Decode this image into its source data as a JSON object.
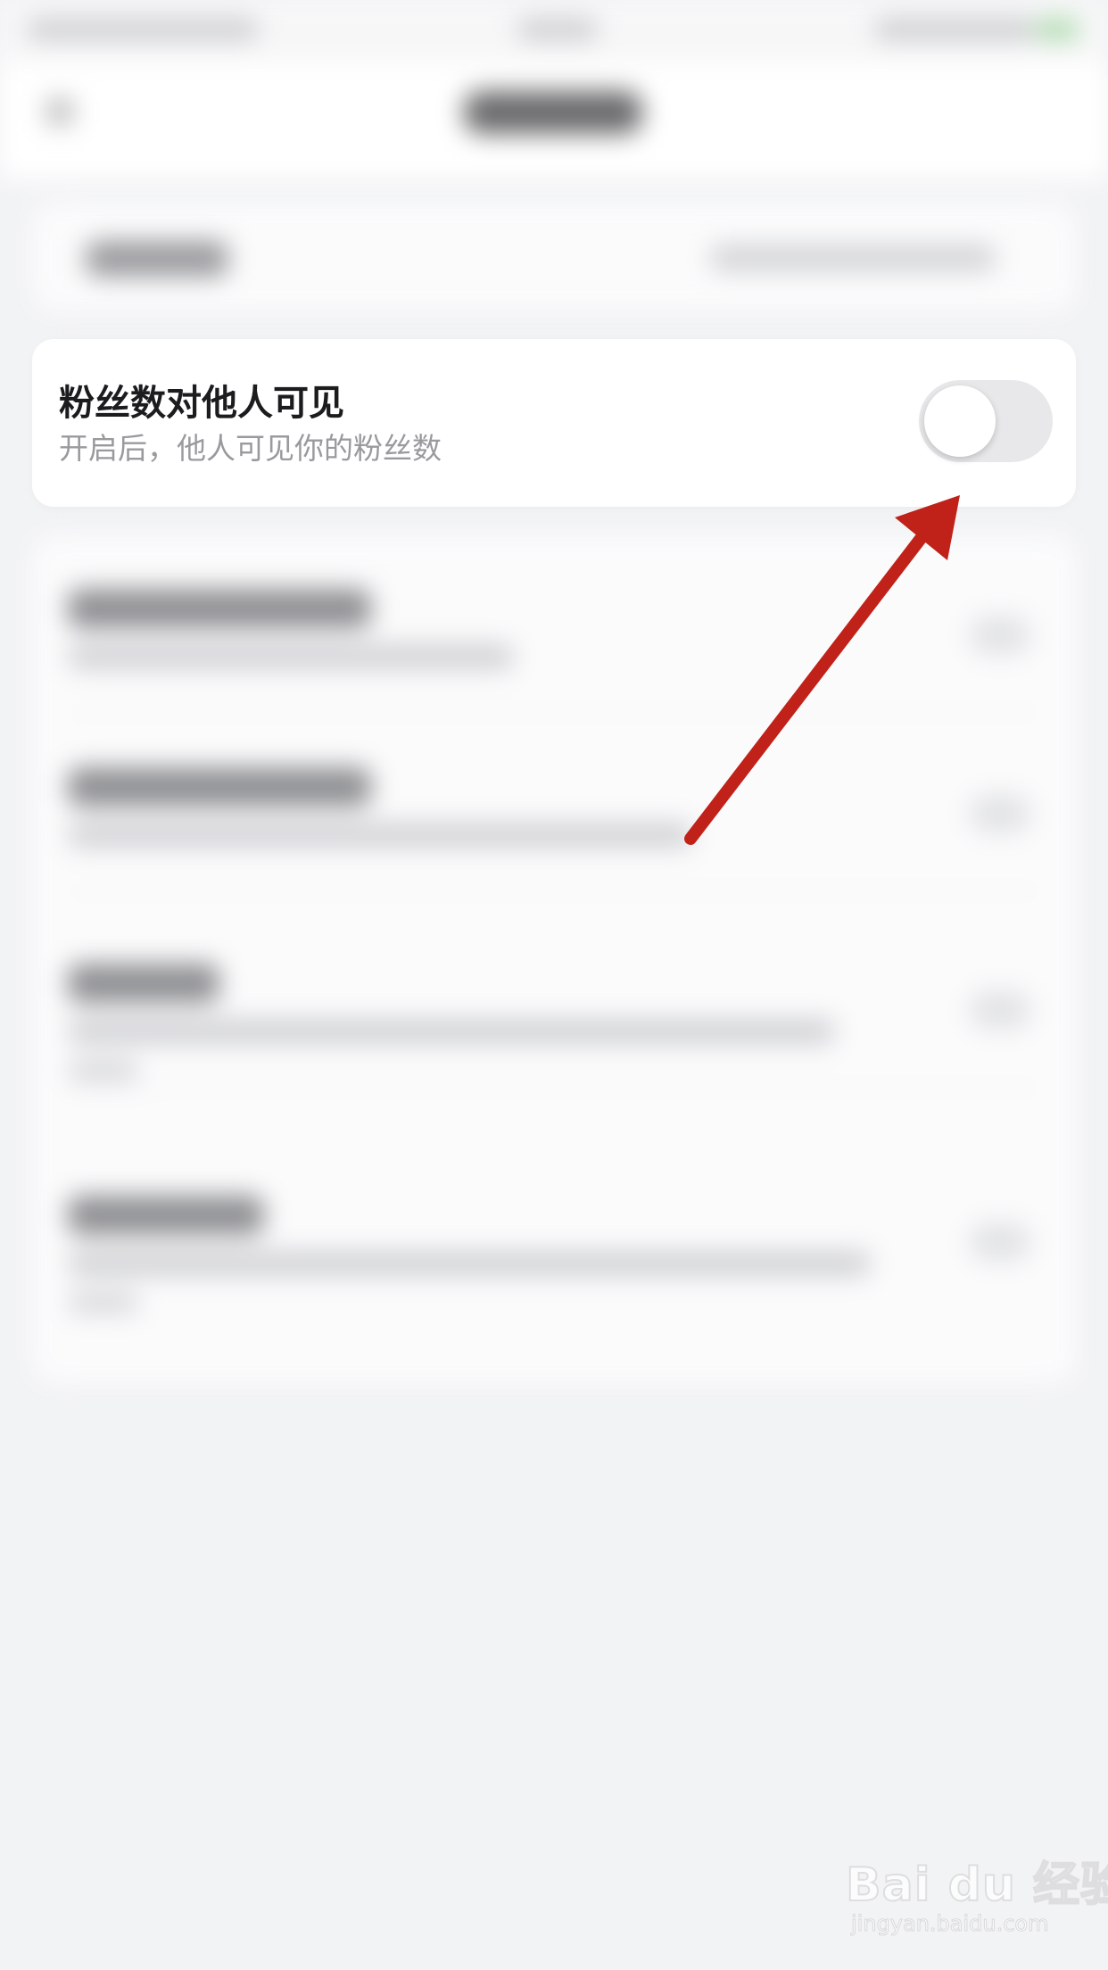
{
  "setting": {
    "title": "粉丝数对他人可见",
    "subtitle": "开启后，他人可见你的粉丝数",
    "toggle_on": false
  },
  "colors": {
    "arrow": "#c0221a",
    "toggle_off": "#e8e8ea",
    "background": "#f2f3f5"
  },
  "watermark": {
    "brand": "Bai du 经验",
    "url": "jingyan.baidu.com"
  }
}
